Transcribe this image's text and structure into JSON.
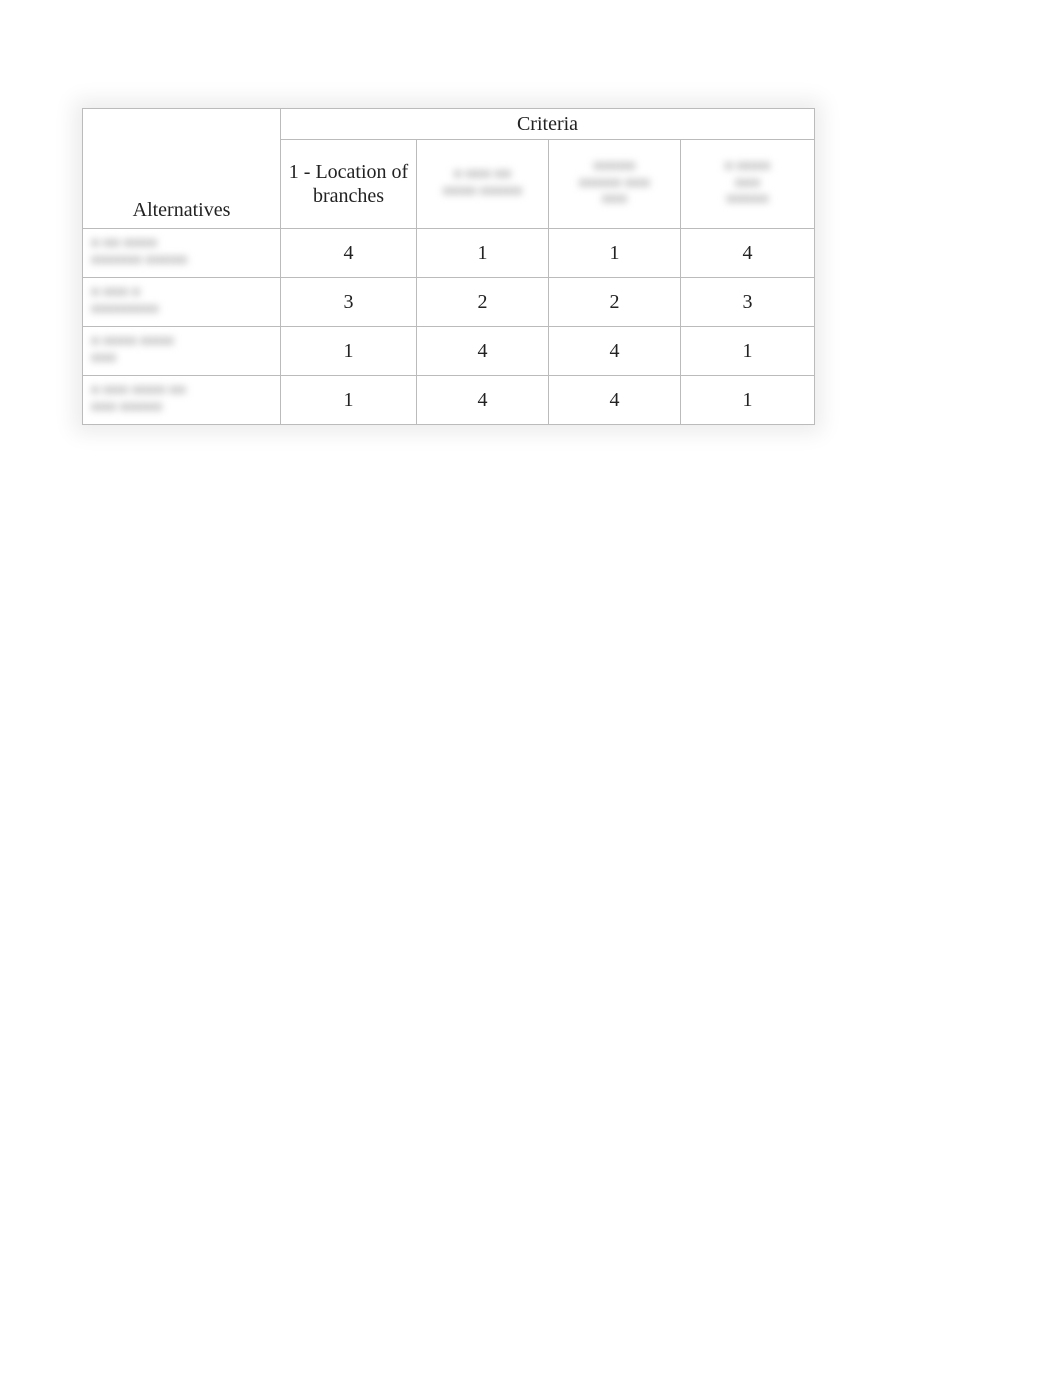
{
  "header": {
    "criteria_label": "Criteria",
    "alternatives_label": "Alternatives"
  },
  "columns": [
    {
      "label": "1 - Location of branches",
      "blurred": false
    },
    {
      "label": "",
      "blurred": true
    },
    {
      "label": "",
      "blurred": true
    },
    {
      "label": "",
      "blurred": true
    }
  ],
  "rows": [
    {
      "label": "",
      "values": [
        "4",
        "1",
        "1",
        "4"
      ]
    },
    {
      "label": "",
      "values": [
        "3",
        "2",
        "2",
        "3"
      ]
    },
    {
      "label": "",
      "values": [
        "1",
        "4",
        "4",
        "1"
      ]
    },
    {
      "label": "",
      "values": [
        "1",
        "4",
        "4",
        "1"
      ]
    }
  ],
  "chart_data": {
    "type": "table",
    "title": "Criteria",
    "row_header": "Alternatives",
    "columns": [
      "1 - Location of branches",
      "(obscured)",
      "(obscured)",
      "(obscured)"
    ],
    "rows": [
      {
        "alternative": "(obscured)",
        "scores": [
          4,
          1,
          1,
          4
        ]
      },
      {
        "alternative": "(obscured)",
        "scores": [
          3,
          2,
          2,
          3
        ]
      },
      {
        "alternative": "(obscured)",
        "scores": [
          1,
          4,
          4,
          1
        ]
      },
      {
        "alternative": "(obscured)",
        "scores": [
          1,
          4,
          4,
          1
        ]
      }
    ]
  }
}
